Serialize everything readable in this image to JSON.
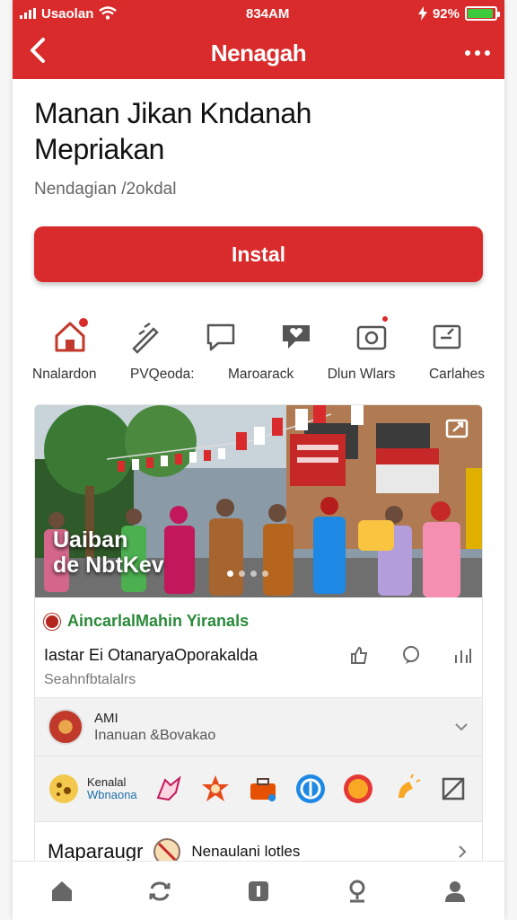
{
  "status_bar": {
    "carrier": "Usaolan",
    "time": "834AM",
    "battery_percent": "92%",
    "battery_level": 0.92
  },
  "navbar": {
    "title": "Nenagah"
  },
  "app": {
    "title_line1": "Manan Jikan Kndanah",
    "title_line2": "Mepriakan",
    "subtitle": "Nendagian /2okdal",
    "install_label": "Instal"
  },
  "actions": [
    {
      "label": "Nnalardon",
      "icon": "home-icon"
    },
    {
      "label": "PVQeoda:",
      "icon": "pencil-link-icon"
    },
    {
      "label": "Maroarack",
      "icon": "chat-bubble-icon"
    },
    {
      "label": "Dlun Wlars",
      "icon": "heart-speech-icon"
    },
    {
      "label": "Carlahes",
      "icon": "camera-badge-icon"
    },
    {
      "label": "",
      "icon": "edit-box-icon"
    }
  ],
  "hero": {
    "caption_line1": "Uaiban",
    "caption_line2": "de NbtKev",
    "dots_total": 4,
    "dots_active": 0
  },
  "post": {
    "source": "AincarlalMahin Yiranals",
    "text": "Iastar Ei OtanaryaOporakalda",
    "meta": "Seahnfbtalalrs"
  },
  "user": {
    "name": "AMI",
    "role": "Inanuan &Bovakao"
  },
  "tools": {
    "first_line1": "Kenalal",
    "first_line2": "Wbnaona",
    "icons": [
      "hand-icon",
      "star-badge-icon",
      "toolbox-icon",
      "blue-circle-icon",
      "gold-circle-icon",
      "sparkle-icon",
      "crop-icon"
    ]
  },
  "footer": {
    "title": "Maparaugr",
    "text": "Nenaulani lotles"
  },
  "colors": {
    "brand": "#d92b2b",
    "source_green": "#2a8a3a"
  }
}
